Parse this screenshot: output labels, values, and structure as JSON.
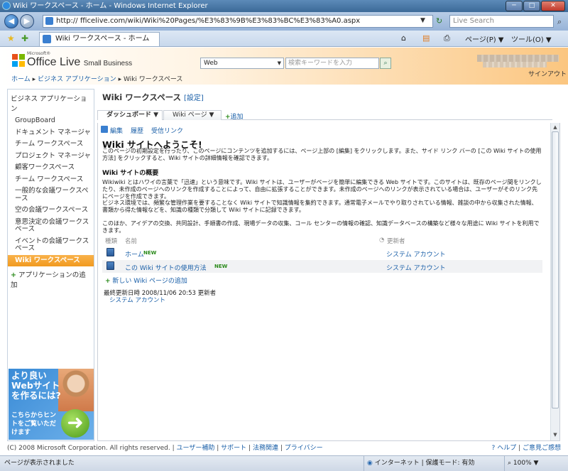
{
  "window": {
    "title": "Wiki ワークスペース - ホーム - Windows Internet Explorer",
    "minimize": "─",
    "maximize": "□",
    "close": "✕"
  },
  "browser": {
    "address": "http://                                    fficelive.com/wiki/Wiki%20Pages/%E3%83%9B%E3%83%BC%E3%83%A0.aspx",
    "search_placeholder": "Live Search",
    "tab_title": "Wiki ワークスペース - ホーム",
    "page_menu": "ページ(P) ▼",
    "tools_menu": "ツール(O) ▼"
  },
  "header": {
    "ms_label": "Microsoft®",
    "product": "Office Live",
    "product_sub": "Small Business",
    "scope": "Web",
    "search_placeholder": "検索キーワードを入力",
    "signout": "サインアウト",
    "breadcrumb": [
      "ホーム",
      "ビジネス アプリケーション",
      "Wiki ワークスペース"
    ]
  },
  "sidebar": {
    "heading": "ビジネス アプリケーション",
    "items": [
      {
        "label": "GroupBoard"
      },
      {
        "label": "ドキュメント マネージャ"
      },
      {
        "label": "チーム ワークスペース"
      },
      {
        "label": "プロジェクト マネージャ"
      },
      {
        "label": "顧客ワークスペース"
      },
      {
        "label": "チーム ワークスペース"
      },
      {
        "label": "一般的な会議ワークスペース"
      },
      {
        "label": "空の会議ワークスペース"
      },
      {
        "label": "意思決定の会議ワークスペース"
      },
      {
        "label": "イベントの会議ワークスペース"
      },
      {
        "label": "Wiki ワークスペース"
      }
    ],
    "add_app": "アプリケーションの追加",
    "ad": {
      "headline": "より良いWebサイトを作るには?",
      "sub": "こちらからヒントをご覧いただけます"
    }
  },
  "main": {
    "title": "Wiki ワークスペース",
    "settings_link": "[設定]",
    "tabs": [
      {
        "label": "ダッシュボード ▼"
      },
      {
        "label": "Wiki ページ ▼"
      }
    ],
    "add_tab": "追加",
    "actions": [
      "編集",
      "履歴",
      "受信リンク"
    ],
    "heading": "Wiki サイトへようこそ!",
    "intro": "このページの初期設定を行ったり、このページにコンテンツを追加するには、ページ上部の [編集] をクリックします。また、サイド リンク バーの [この Wiki サイトの使用方法] をクリックすると、Wiki サイトの詳細情報を確認できます。",
    "overview_heading": "Wiki サイトの概要",
    "overview_p1": "Wikiwiki とはハワイの言葉で「迅速」という意味です。Wiki サイトは、ユーザーがページを簡単に編集できる Web サイトです。このサイトは、既存のページ間をリンクしたり、未作成のページへのリンクを作成することによって、自由に拡張することができます。未作成のページへのリンクが表示されている場合は、ユーザーがそのリンク先にページを作成できます。",
    "overview_p2": "ビジネス環境では、頻繁な管理作業を要することなく Wiki サイトで知識情報を集約できます。通常電子メールでやり取りされている情報、雑談の中から収集された情報、書類から得た情報などを、知識の種類で分類して Wiki サイトに記録できます。",
    "overview_p3": "このほか、アイデアの交換、共同設計、手順書の作成、現場データの収集、コール センターの情報の確認、知識データベースの構築など様々な用途に Wiki サイトを利用できます。",
    "table": {
      "col_type": "種類",
      "col_name": "名前",
      "col_modified_by": "更新者",
      "rows": [
        {
          "name": "ホーム",
          "badge": "NEW",
          "modified_by": "システム アカウント"
        },
        {
          "name": "この Wiki サイトの使用方法",
          "badge": "NEW",
          "modified_by": "システム アカウント"
        }
      ]
    },
    "new_page": "新しい Wiki ページの追加",
    "last_modified": "最終更新日時 2008/11/06 20:53  更新者",
    "last_modified_by": "システム アカウント"
  },
  "footer": {
    "copyright": "(C) 2008 Microsoft Corporation. All rights reserved.",
    "links": [
      "ユーザー補助",
      "サポート",
      "法務関連",
      "プライバシー"
    ],
    "help": "ヘルプ",
    "feedback": "ご意見ご感想"
  },
  "status": {
    "message": "ページが表示されました",
    "zone": "インターネット | 保護モード: 有効",
    "zoom": "100%"
  },
  "colors": {
    "accent": "#f19a1f",
    "link": "#1a5fa8"
  }
}
